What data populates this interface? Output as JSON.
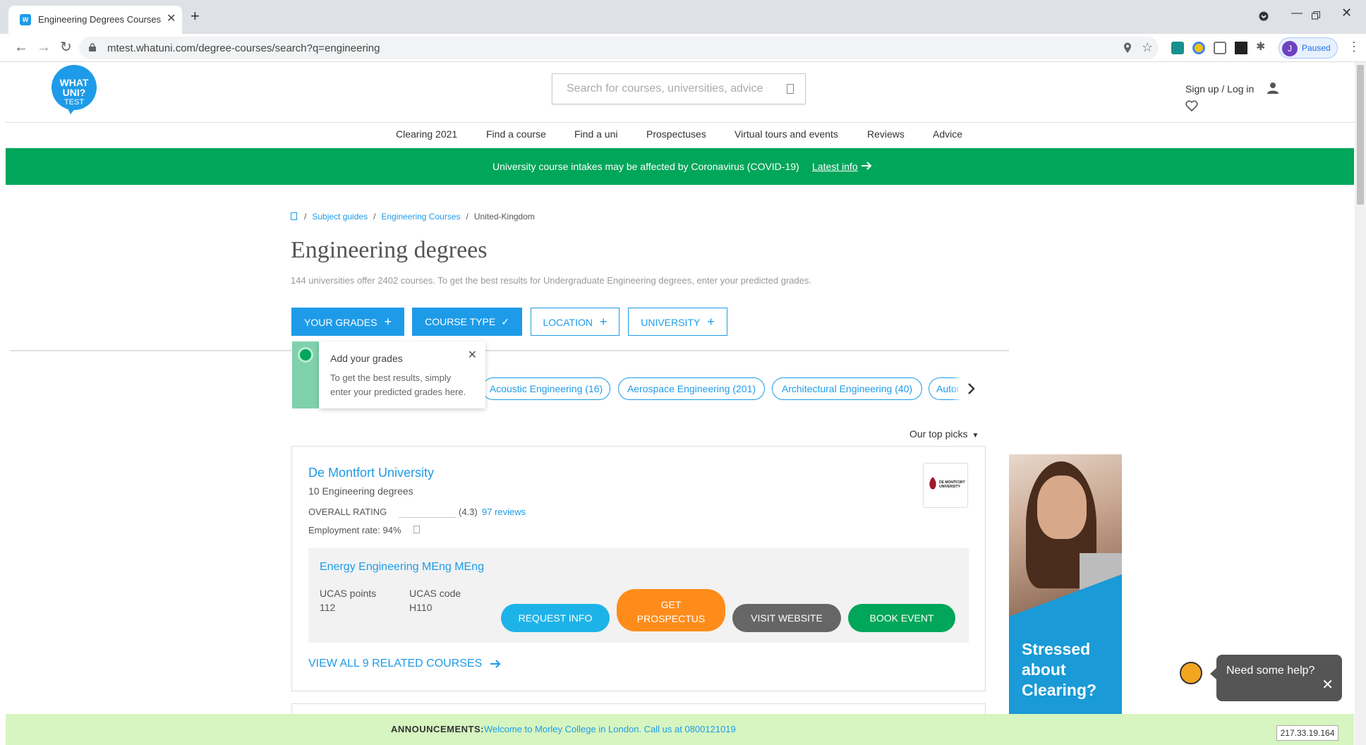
{
  "browser": {
    "tab_title": "Engineering Degrees Courses in",
    "url": "mtest.whatuni.com/degree-courses/search?q=engineering",
    "profile_initial": "J",
    "profile_status": "Paused"
  },
  "header": {
    "logo_line1": "WHAT",
    "logo_line2": "UNI?",
    "logo_line3": "TEST",
    "search_placeholder": "Search for courses, universities, advice",
    "signup_label": "Sign up / Log in"
  },
  "nav": {
    "items": [
      "Clearing 2021",
      "Find a course",
      "Find a uni",
      "Prospectuses",
      "Virtual tours and events",
      "Reviews",
      "Advice"
    ]
  },
  "covid_banner": {
    "text": "University course intakes may be affected by Coronavirus (COVID-19)",
    "link": "Latest info"
  },
  "breadcrumb": {
    "items": [
      "Subject guides",
      "Engineering Courses",
      "United-Kingdom"
    ]
  },
  "page": {
    "title": "Engineering degrees",
    "summary": "144 universities offer 2402 courses. To get the best results for Undergraduate Engineering degrees, enter your predicted grades."
  },
  "filters": {
    "grades": "YOUR GRADES",
    "course_type": "COURSE TYPE",
    "location": "LOCATION",
    "university": "UNIVERSITY"
  },
  "tooltip": {
    "title": "Add your grades",
    "body": "To get the best results, simply enter your predicted grades here."
  },
  "chips": [
    "Acoustic Engineering (16)",
    "Aerospace Engineering (201)",
    "Architectural Engineering (40)",
    "Autor"
  ],
  "sort": {
    "label": "Our top picks"
  },
  "result": {
    "university": "De Montfort University",
    "degree_count": "10 Engineering degrees",
    "rating_label": "OVERALL RATING",
    "rating_value": "(4.3)",
    "reviews": "97 reviews",
    "employment": "Employment rate: 94%",
    "logo_text": "DE MONTFORT UNIVERSITY",
    "course": {
      "name": "Energy Engineering MEng MEng",
      "ucas_points_label": "UCAS points",
      "ucas_points": "112",
      "ucas_code_label": "UCAS code",
      "ucas_code": "H110"
    },
    "buttons": {
      "request": "REQUEST INFO",
      "prospectus_line1": "GET",
      "prospectus_line2": "PROSPECTUS",
      "website": "VISIT WEBSITE",
      "event": "BOOK EVENT"
    },
    "view_all": "VIEW ALL 9 RELATED COURSES"
  },
  "ad": {
    "text": "Stressed about Clearing?"
  },
  "help": {
    "text": "Need some help?"
  },
  "announcement": {
    "label": "ANNOUNCEMENTS:",
    "message": "Welcome to Morley College in London. Call us at 0800121019"
  },
  "ip": "217.33.19.164",
  "colors": {
    "brand_blue": "#1e9be8",
    "brand_green": "#00a65a",
    "orange": "#ff8c1a"
  }
}
